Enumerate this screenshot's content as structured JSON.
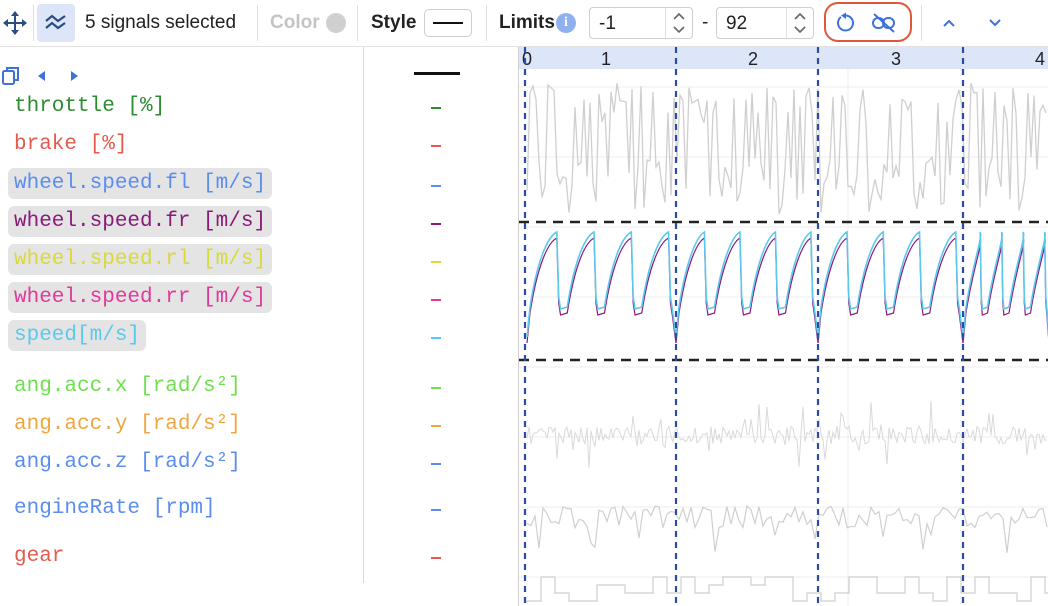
{
  "toolbar": {
    "selection_text": "5 signals selected",
    "color_label": "Color",
    "style_label": "Style",
    "limits_label": "Limits",
    "limit_min": "-1",
    "limit_separator": "-",
    "limit_max": "92",
    "icons": [
      "move-arrows-icon",
      "multi-signal-icon",
      "info-icon",
      "reset-icon",
      "unlink-icon",
      "arrow-up-icon",
      "arrow-down-icon"
    ]
  },
  "legend": {
    "nav_icons": [
      "copy-icon",
      "prev-icon",
      "next-icon"
    ]
  },
  "signals": [
    {
      "label": "throttle [%]",
      "color": "#2e8b2e",
      "selected": false
    },
    {
      "label": "brake [%]",
      "color": "#e15b4f",
      "selected": false
    },
    {
      "label": "wheel.speed.fl [m/s]",
      "color": "#5b8def",
      "selected": true
    },
    {
      "label": "wheel.speed.fr [m/s]",
      "color": "#8a1a7a",
      "selected": true
    },
    {
      "label": "wheel.speed.rl [m/s]",
      "color": "#d9d93a",
      "selected": true
    },
    {
      "label": "wheel.speed.rr [m/s]",
      "color": "#e0399a",
      "selected": true
    },
    {
      "label": "speed[m/s]",
      "color": "#5cc8ee",
      "selected": true
    },
    {
      "label": "ang.acc.x [rad/s²]",
      "color": "#6ee04f",
      "selected": false
    },
    {
      "label": "ang.acc.y [rad/s²]",
      "color": "#f0a640",
      "selected": false
    },
    {
      "label": "ang.acc.z [rad/s²]",
      "color": "#5b8def",
      "selected": false
    },
    {
      "label": "engineRate [rpm]",
      "color": "#5b8def",
      "selected": false
    },
    {
      "label": "gear",
      "color": "#e15b4f",
      "selected": false
    }
  ],
  "timeline": {
    "labels": [
      "0",
      "1",
      "2",
      "3",
      "4"
    ]
  },
  "colors": {
    "accent": "#5b8def",
    "highlight_ring": "#e0563b",
    "selection_bg": "#e4e4e4",
    "ruler_bg": "#dce6f8"
  }
}
